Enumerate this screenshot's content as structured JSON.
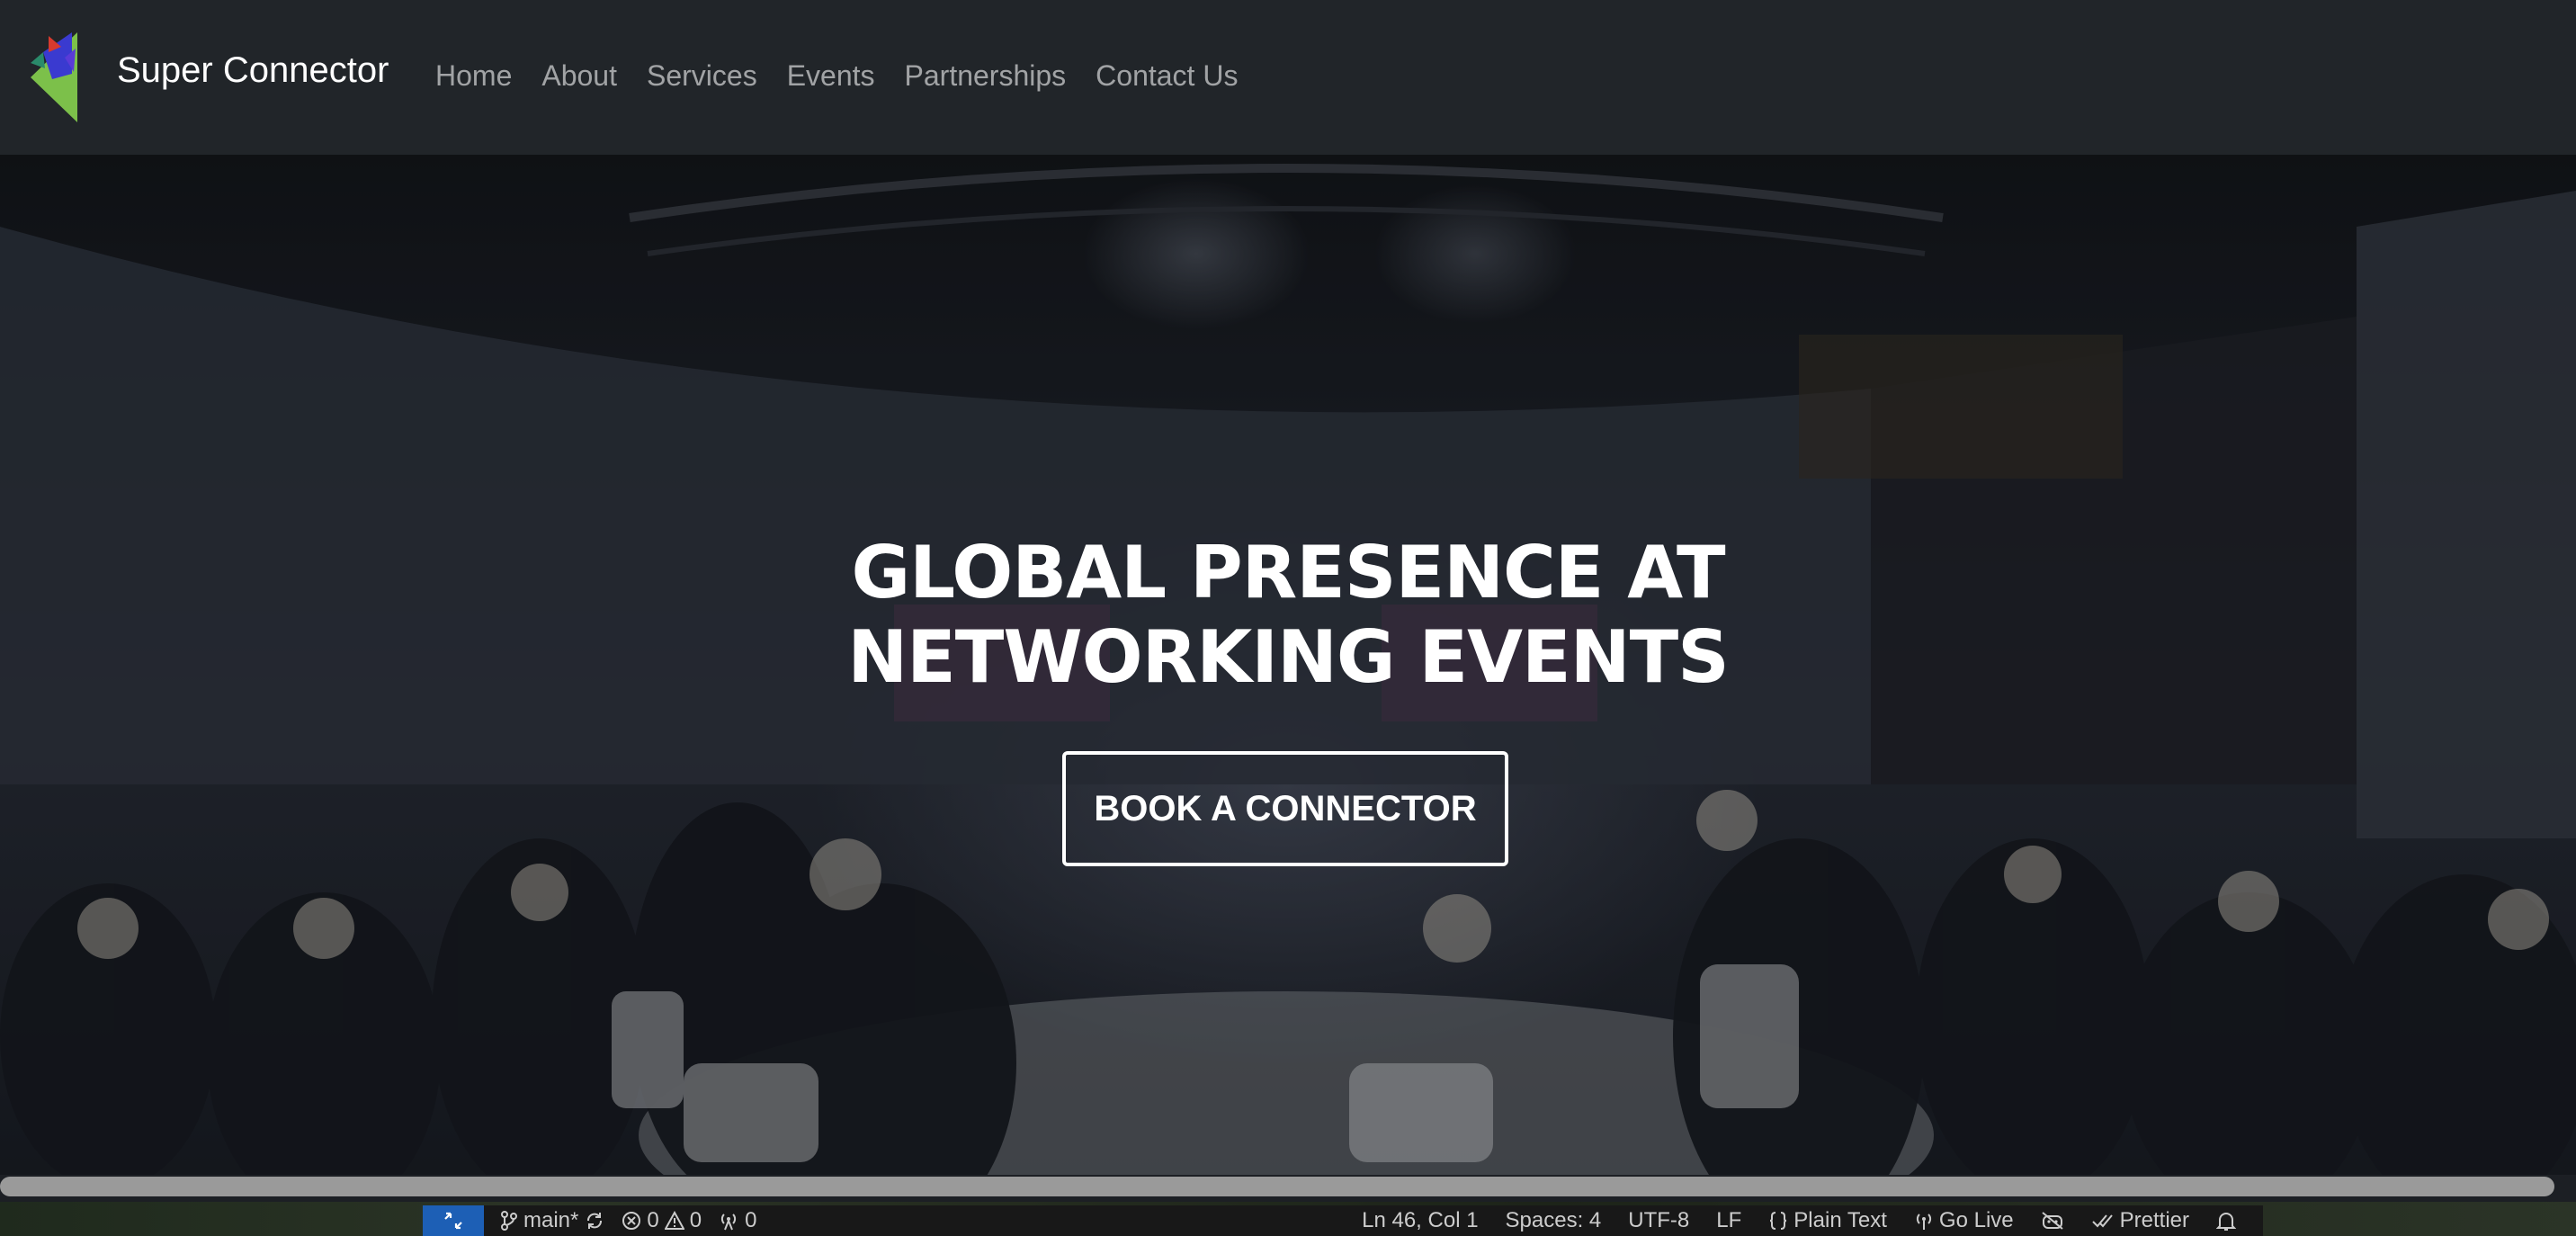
{
  "navbar": {
    "brand": "Super Connector",
    "links": [
      "Home",
      "About",
      "Services",
      "Events",
      "Partnerships",
      "Contact Us"
    ]
  },
  "hero": {
    "title_line1": "GLOBAL PRESENCE AT",
    "title_line2": "NETWORKING EVENTS",
    "cta_label": "BOOK A CONNECTOR"
  },
  "statusbar": {
    "branch": "main*",
    "errors": "0",
    "warnings": "0",
    "ports": "0",
    "cursor_position": "Ln 46, Col 1",
    "spaces": "Spaces: 4",
    "encoding": "UTF-8",
    "eol": "LF",
    "language": "Plain Text",
    "go_live": "Go Live",
    "prettier": "Prettier"
  },
  "colors": {
    "navbar_bg": "#212529",
    "nav_link": "#8f9194",
    "remote_button": "#1d5fb5",
    "logo_green": "#7cc04a",
    "logo_blue": "#3a3ad0",
    "logo_red": "#d83a2e"
  },
  "icons": {
    "logo": "super-connector-logo",
    "remote": "remote-icon",
    "branch": "git-branch-icon",
    "sync": "sync-icon",
    "errors": "error-icon",
    "warnings": "warning-icon",
    "ports": "broadcast-icon",
    "language": "braces-icon",
    "go_live": "broadcast-icon",
    "copilot": "copilot-icon",
    "prettier": "double-check-icon",
    "notifications": "bell-icon"
  }
}
